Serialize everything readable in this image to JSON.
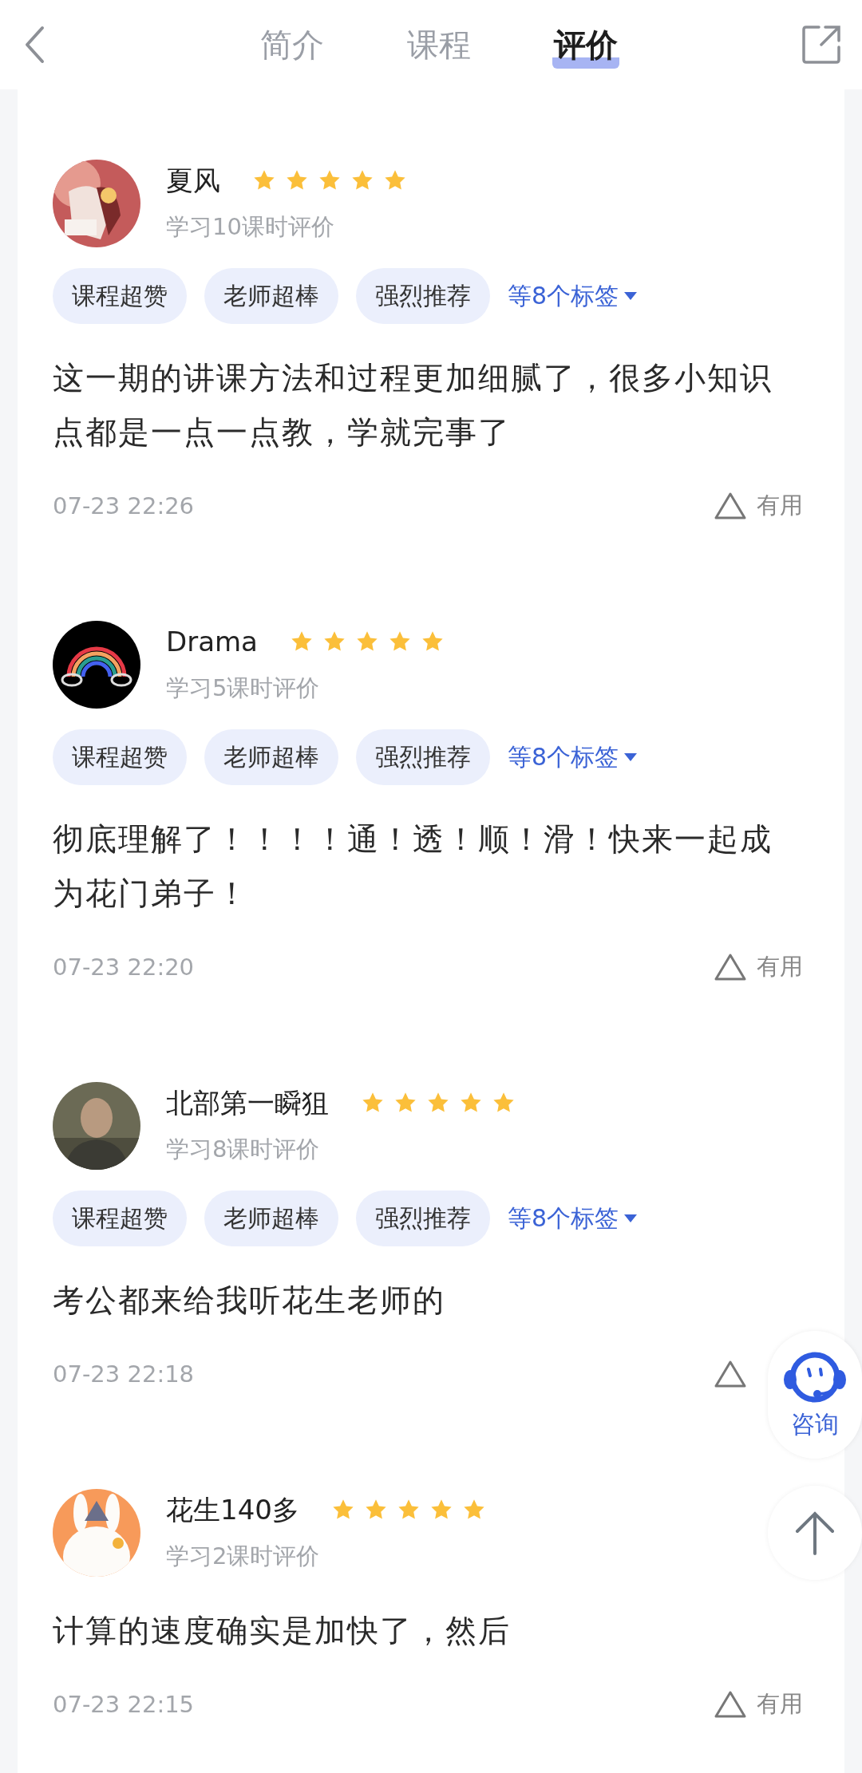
{
  "tabs": [
    {
      "label": "简介",
      "selected": false
    },
    {
      "label": "课程",
      "selected": false
    },
    {
      "label": "评价",
      "selected": true
    }
  ],
  "reviews": [
    {
      "name": "夏风",
      "stars": 5,
      "subtitle": "学习10课时评价",
      "tags": [
        "课程超赞",
        "老师超棒",
        "强烈推荐"
      ],
      "more_tags": "等8个标签",
      "comment": "这一期的讲课方法和过程更加细腻了，很多小知识点都是一点一点教，学就完事了",
      "time": "07-23 22:26",
      "useful": "有用"
    },
    {
      "name": "Drama",
      "stars": 5,
      "subtitle": "学习5课时评价",
      "tags": [
        "课程超赞",
        "老师超棒",
        "强烈推荐"
      ],
      "more_tags": "等8个标签",
      "comment": "彻底理解了！！！！通！透！顺！滑！快来一起成为花门弟子！",
      "time": "07-23 22:20",
      "useful": "有用"
    },
    {
      "name": "北部第一瞬狙",
      "stars": 5,
      "subtitle": "学习8课时评价",
      "tags": [
        "课程超赞",
        "老师超棒",
        "强烈推荐"
      ],
      "more_tags": "等8个标签",
      "comment": "考公都来给我听花生老师的",
      "time": "07-23 22:18"
    },
    {
      "name": "花生140多",
      "stars": 5,
      "subtitle": "学习2课时评价",
      "comment": "计算的速度确实是加快了，然后",
      "time": "07-23 22:15",
      "useful": "有用"
    }
  ],
  "consult": {
    "label": "咨询"
  }
}
